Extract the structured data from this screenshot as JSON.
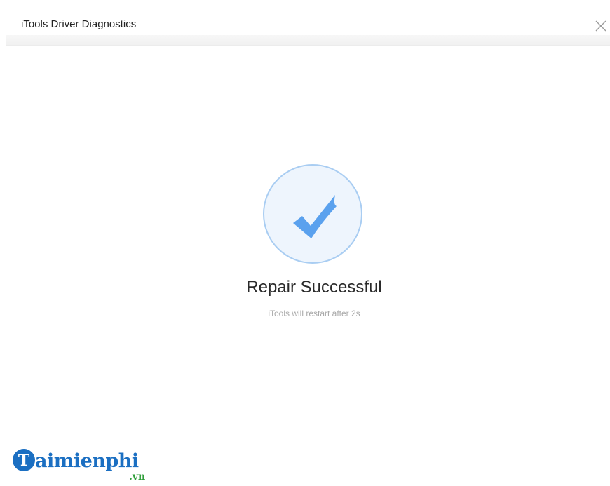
{
  "window": {
    "title": "iTools Driver Diagnostics",
    "close_icon": "close-icon"
  },
  "result": {
    "icon": "checkmark-icon",
    "title": "Repair Successful",
    "subtitle": "iTools will restart after 2s"
  },
  "watermark": {
    "brand": "aimienphi",
    "suffix": ".vn",
    "logo_letter": "T"
  },
  "colors": {
    "accent": "#5aa1ee",
    "circle_bg": "#eef5fd",
    "circle_border": "#a9cdf2",
    "watermark_blue": "#1b6fc2",
    "watermark_green": "#2f9e3a"
  }
}
